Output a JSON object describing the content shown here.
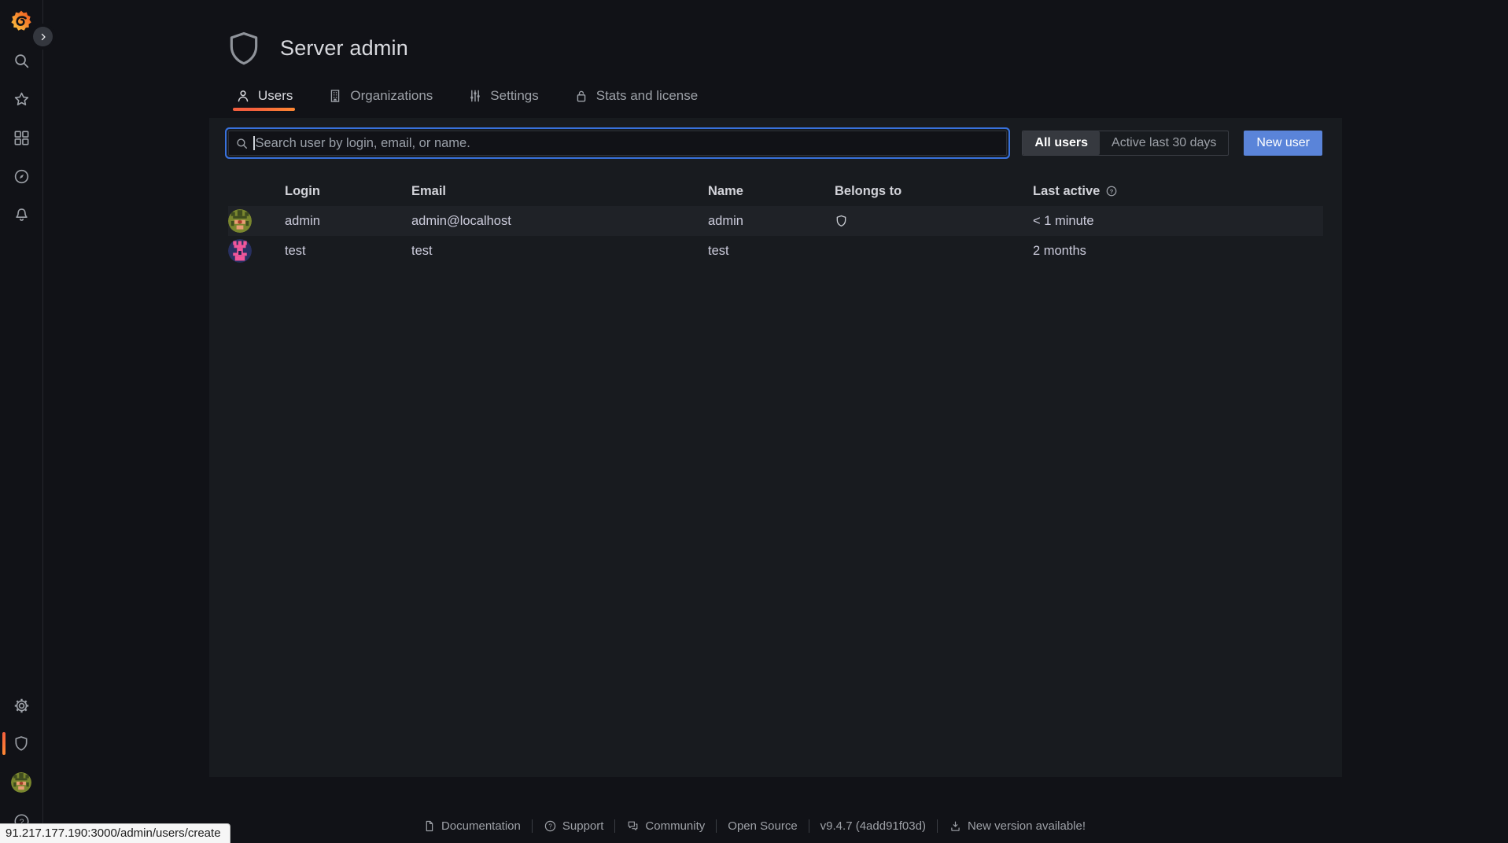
{
  "colors": {
    "page_bg": "#111217",
    "panel_bg": "#181b1f",
    "accent_orange": "#ff8833",
    "accent_orange_deep": "#f55f3e",
    "primary_button_blue": "#5a84d9",
    "focus_ring_blue": "#3871dc"
  },
  "header": {
    "title": "Server admin"
  },
  "tabs": [
    {
      "label": "Users",
      "active": true
    },
    {
      "label": "Organizations",
      "active": false
    },
    {
      "label": "Settings",
      "active": false
    },
    {
      "label": "Stats and license",
      "active": false
    }
  ],
  "toolbar": {
    "search_placeholder": "Search user by login, email, or name.",
    "filters": [
      {
        "label": "All users",
        "selected": true
      },
      {
        "label": "Active last 30 days",
        "selected": false
      }
    ],
    "new_user_label": "New user"
  },
  "table": {
    "columns": [
      "Login",
      "Email",
      "Name",
      "Belongs to",
      "Last active"
    ],
    "rows": [
      {
        "login": "admin",
        "email": "admin@localhost",
        "name": "admin",
        "belongs_to_icon": "shield",
        "last_active": "< 1 minute"
      },
      {
        "login": "test",
        "email": "test",
        "name": "test",
        "belongs_to_icon": "",
        "last_active": "2 months"
      }
    ]
  },
  "footer": {
    "documentation": "Documentation",
    "support": "Support",
    "community": "Community",
    "open_source": "Open Source",
    "version": "v9.4.7 (4add91f03d)",
    "new_version": "New version available!"
  },
  "browser": {
    "link_preview": "91.217.177.190:3000/admin/users/create"
  }
}
